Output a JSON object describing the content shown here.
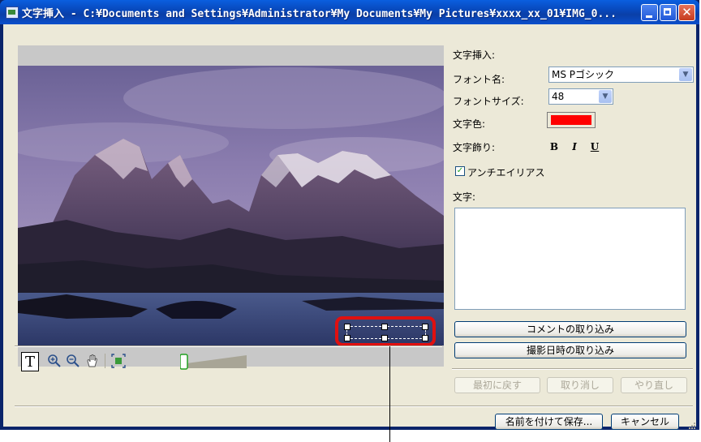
{
  "window": {
    "title": "文字挿入 - C:¥Documents and Settings¥Administrator¥My Documents¥My Pictures¥xxxx_xx_01¥IMG_0..."
  },
  "panel": {
    "heading": "文字挿入:",
    "font_name_label": "フォント名:",
    "font_name_value": "MS Pゴシック",
    "font_size_label": "フォントサイズ:",
    "font_size_value": "48",
    "text_color_label": "文字色:",
    "text_color_value": "#ff0000",
    "text_decoration_label": "文字飾り:",
    "bold_label": "B",
    "italic_label": "I",
    "underline_label": "U",
    "antialias_label": "アンチエイリアス",
    "antialias_checked": true,
    "text_label": "文字:",
    "text_value": "",
    "import_comment_label": "コメントの取り込み",
    "import_datetime_label": "撮影日時の取り込み"
  },
  "actions": {
    "reset_label": "最初に戻す",
    "undo_label": "取り消し",
    "redo_label": "やり直し",
    "save_as_label": "名前を付けて保存...",
    "cancel_label": "キャンセル"
  },
  "toolbar": {
    "text_tool_label": "T",
    "icons": [
      "zoom-in-icon",
      "zoom-out-icon",
      "hand-icon",
      "fit-icon"
    ],
    "zoom_level": 0
  },
  "colors": {
    "selection_highlight": "#e01010",
    "titlebar": "#0a5fdf"
  }
}
